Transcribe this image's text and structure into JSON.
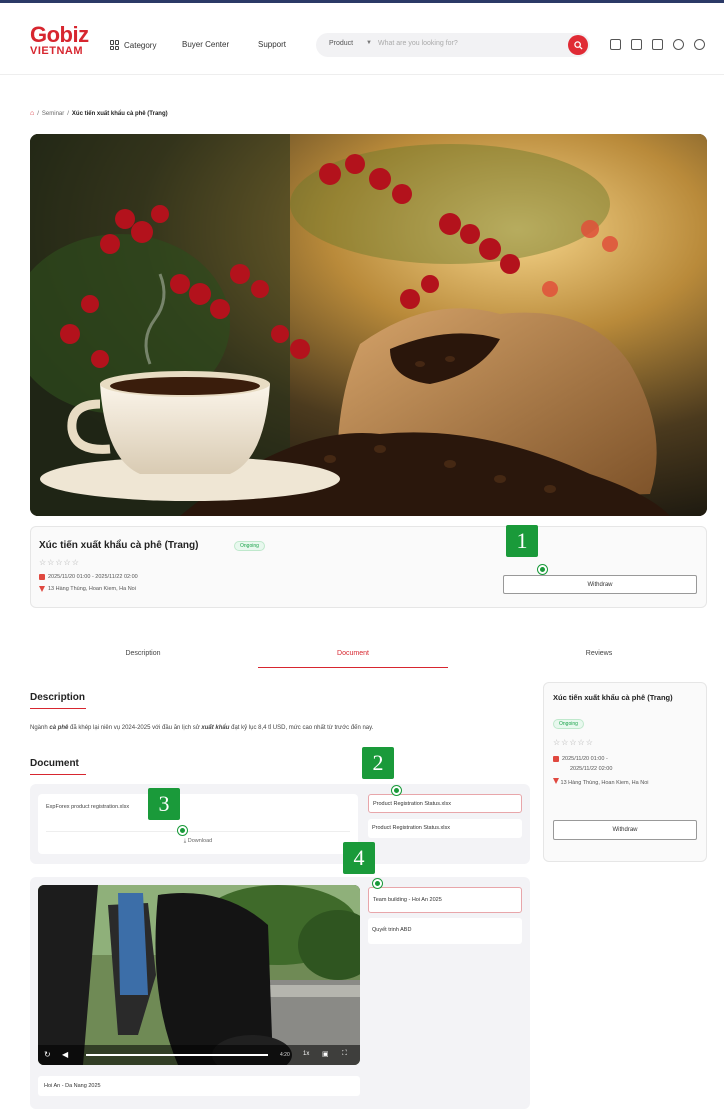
{
  "header": {
    "logo_top": "Gobiz",
    "logo_bottom": "VIETNAM",
    "nav_category": "Category",
    "nav_buyer_center": "Buyer Center",
    "nav_support": "Support",
    "search_scope": "Product",
    "search_placeholder": "What are you looking for?",
    "icons": [
      "message-icon",
      "grid-icon",
      "document-icon",
      "heart-icon",
      "user-icon"
    ]
  },
  "breadcrumb": {
    "home_icon": "home-icon",
    "parent": "Seminar",
    "current": "Xúc tiến xuất khẩu cà phê (Trang)"
  },
  "event": {
    "title": "Xúc tiến xuất khẩu cà phê (Trang)",
    "status": "Ongoing",
    "stars": "☆☆☆☆☆",
    "date_range": "2025/11/20 01:00 - 2025/11/22 02:00",
    "location": "13 Hàng Thùng, Hoan Kiem, Ha Noi",
    "withdraw_label": "Withdraw"
  },
  "tabs": [
    "Description",
    "Document",
    "Reviews"
  ],
  "active_tab": "Document",
  "description": {
    "heading": "Description",
    "text_before": "Ngành ",
    "bold1": "cà phê",
    "text_mid": " đã khép lại niên vụ 2024-2025 với đầu ăn lịch sử ",
    "bold2": "xuất khẩu",
    "text_after": " đạt kỷ lục 8,4 tỉ USD, mức cao nhất từ trước đến nay."
  },
  "documents": {
    "heading": "Document",
    "main_file": "ExpForex product registration.xlsx",
    "download_label": "Download",
    "files": [
      "Product Registration Status.xlsx",
      "Product Registration Status.xlsx"
    ]
  },
  "videos": {
    "caption": "Hoi An - Da Nang 2025",
    "time": "4:20",
    "speed": "1x",
    "items": [
      "Team building - Hoi An 2025",
      "Quyết trinh ABD"
    ]
  },
  "sidebar": {
    "title": "Xúc tiến xuất khẩu cà phê (Trang)",
    "status": "Ongoing",
    "stars": "☆☆☆☆☆",
    "date_start": "2025/11/20 01:00 -",
    "date_end": "2025/11/22 02:00",
    "location": "13 Hàng Thùng, Hoan Kiem, Ha Noi",
    "withdraw_label": "Withdraw"
  },
  "markers": [
    "1",
    "2",
    "3",
    "4"
  ],
  "colors": {
    "brand_red": "#d7262f",
    "marker_green": "#1a9a3a",
    "ongoing_green": "#1aa34a"
  }
}
